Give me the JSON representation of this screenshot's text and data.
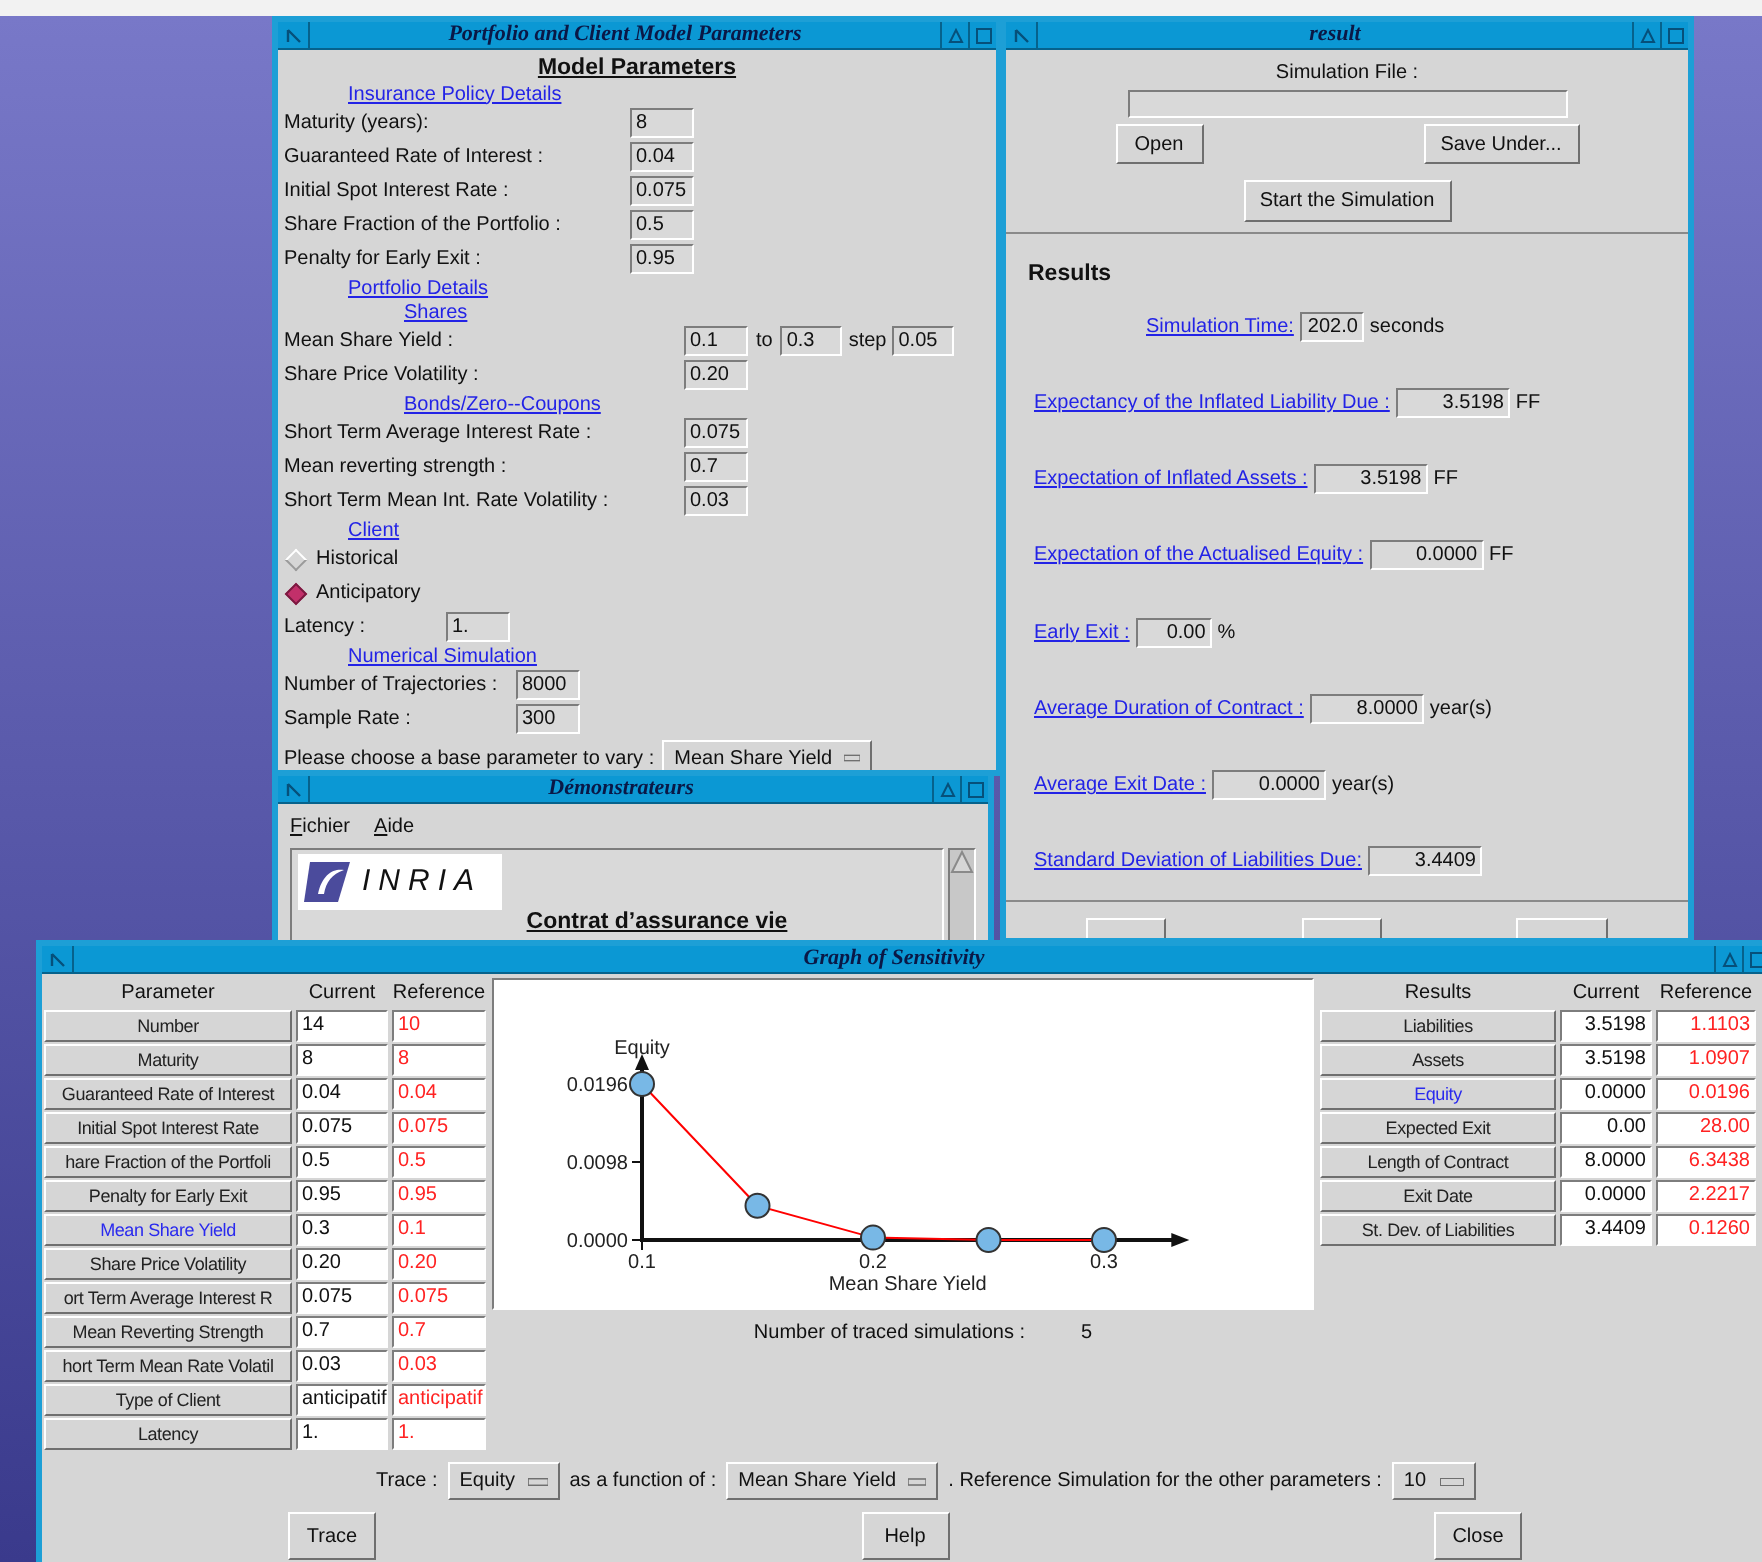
{
  "parameters_window": {
    "title": "Portfolio and Client Model Parameters",
    "heading": "Model Parameters",
    "sections": [
      {
        "kind": "policy",
        "title": "Insurance Policy Details",
        "fields": [
          {
            "label": "Maturity (years):",
            "value": "8"
          },
          {
            "label": "Guaranteed Rate of Interest :",
            "value": "0.04"
          },
          {
            "label": "Initial Spot Interest Rate :",
            "value": "0.075"
          },
          {
            "label": "Share Fraction of the Portfolio :",
            "value": "0.5"
          },
          {
            "label": "Penalty for Early Exit :",
            "value": "0.95"
          }
        ]
      },
      {
        "kind": "portfolio",
        "title": "Portfolio Details",
        "subsections": [
          {
            "title": "Shares",
            "fields": [
              {
                "label": "Mean Share Yield :",
                "value": "0.1",
                "to_label": "to",
                "to": "0.3",
                "step_label": "step",
                "step": "0.05"
              },
              {
                "label": "Share Price Volatility :",
                "value": "0.20"
              }
            ]
          },
          {
            "title": "Bonds/Zero--Coupons",
            "fields": [
              {
                "label": "Short Term Average Interest Rate :",
                "value": "0.075"
              },
              {
                "label": "Mean reverting strength :",
                "value": "0.7"
              },
              {
                "label": "Short Term Mean Int. Rate Volatility :",
                "value": "0.03"
              }
            ]
          }
        ]
      },
      {
        "kind": "client",
        "title": "Client",
        "options": [
          {
            "label": "Historical",
            "selected": false
          },
          {
            "label": "Anticipatory",
            "selected": true
          }
        ],
        "fields": [
          {
            "label": "Latency :",
            "value": "1."
          }
        ]
      },
      {
        "kind": "simulation",
        "title": "Numerical Simulation",
        "fields": [
          {
            "label": "Number of Trajectories :",
            "value": "8000"
          },
          {
            "label": "Sample Rate :",
            "value": "300"
          }
        ]
      }
    ],
    "base_parameter": {
      "label": "Please choose a base parameter to vary :",
      "value": "Mean Share Yield"
    }
  },
  "result_window": {
    "title": "result",
    "file_label": "Simulation File :",
    "open_button": "Open",
    "save_button": "Save Under...",
    "start_button": "Start the Simulation",
    "results_heading": "Results",
    "results": [
      {
        "kind": "timing",
        "label": "Simulation Time:",
        "value": "202.0",
        "unit": "seconds"
      },
      {
        "kind": "metric",
        "label": "Expectancy of the Inflated Liability Due :",
        "value": "3.5198",
        "unit": "FF"
      },
      {
        "kind": "metric",
        "label": "Expectation of Inflated Assets :",
        "value": "3.5198",
        "unit": "FF"
      },
      {
        "kind": "metric",
        "label": "Expectation of the Actualised Equity :",
        "value": "0.0000",
        "unit": "FF"
      },
      {
        "kind": "percent",
        "label": "Early Exit :",
        "value": "0.00",
        "unit": "%"
      },
      {
        "kind": "metric",
        "label": "Average Duration of Contract :",
        "value": "8.0000",
        "unit": "year(s)"
      },
      {
        "kind": "metric",
        "label": "Average Exit Date :",
        "value": "0.0000",
        "unit": "year(s)"
      },
      {
        "kind": "metric",
        "label": "Standard Deviation of Liabilities Due:",
        "value": "3.4409"
      }
    ]
  },
  "demo_window": {
    "title": "Démonstrateurs",
    "menu": [
      "Fichier",
      "Aide"
    ],
    "logo_text": "INRIA",
    "heading": "Contrat d’assurance vie"
  },
  "graph_window": {
    "title": "Graph of Sensitivity",
    "parameters_table": {
      "columns": [
        "Parameter",
        "Current",
        "Reference"
      ],
      "rows": [
        {
          "name": "Number",
          "current": "14",
          "reference": "10",
          "selected": false
        },
        {
          "name": "Maturity",
          "current": "8",
          "reference": "8",
          "selected": false
        },
        {
          "name": "Guaranteed Rate of Interest",
          "current": "0.04",
          "reference": "0.04",
          "selected": false
        },
        {
          "name": "Initial Spot Interest Rate",
          "current": "0.075",
          "reference": "0.075",
          "selected": false
        },
        {
          "name": "hare Fraction of the Portfoli",
          "current": "0.5",
          "reference": "0.5",
          "selected": false
        },
        {
          "name": "Penalty for Early Exit",
          "current": "0.95",
          "reference": "0.95",
          "selected": false
        },
        {
          "name": "Mean Share Yield",
          "current": "0.3",
          "reference": "0.1",
          "selected": true
        },
        {
          "name": "Share Price Volatility",
          "current": "0.20",
          "reference": "0.20",
          "selected": false
        },
        {
          "name": "ort Term Average Interest R",
          "current": "0.075",
          "reference": "0.075",
          "selected": false
        },
        {
          "name": "Mean Reverting Strength",
          "current": "0.7",
          "reference": "0.7",
          "selected": false
        },
        {
          "name": "hort Term Mean Rate Volatil",
          "current": "0.03",
          "reference": "0.03",
          "selected": false
        },
        {
          "name": "Type of Client",
          "current": "anticipatif",
          "reference": "anticipatif",
          "selected": false
        },
        {
          "name": "Latency",
          "current": "1.",
          "reference": "1.",
          "selected": false
        }
      ]
    },
    "chart_data": {
      "type": "line",
      "xlabel": "Mean Share Yield",
      "ylabel": "Equity",
      "x": [
        0.1,
        0.15,
        0.2,
        0.25,
        0.3
      ],
      "series": [
        {
          "color": "#ff0000",
          "marker": "o",
          "values": [
            0.0196,
            0.0043,
            0.0003,
            0,
            0
          ]
        }
      ],
      "xlim": [
        0.1,
        0.33
      ],
      "ylim": [
        0,
        0.0216
      ],
      "xticks": [
        0.1,
        0.2,
        0.3
      ],
      "yticks": [
        {
          "value": 0,
          "label": "0.0000"
        },
        {
          "value": 0.0098,
          "label": "0.0098"
        },
        {
          "value": 0.0196,
          "label": "0.0196"
        }
      ]
    },
    "traced": {
      "label": "Number of traced simulations :",
      "value": "5"
    },
    "results_table": {
      "columns": [
        "Results",
        "Current",
        "Reference"
      ],
      "rows": [
        {
          "name": "Liabilities",
          "current": "3.5198",
          "reference": "1.1103",
          "selected": false
        },
        {
          "name": "Assets",
          "current": "3.5198",
          "reference": "1.0907",
          "selected": false
        },
        {
          "name": "Equity",
          "current": "0.0000",
          "reference": "0.0196",
          "selected": true
        },
        {
          "name": "Expected Exit",
          "current": "0.00",
          "reference": "28.00",
          "selected": false
        },
        {
          "name": "Length of Contract",
          "current": "8.0000",
          "reference": "6.3438",
          "selected": false
        },
        {
          "name": "Exit Date",
          "current": "0.0000",
          "reference": "2.2217",
          "selected": false
        },
        {
          "name": "St. Dev. of Liabilities",
          "current": "3.4409",
          "reference": "0.1260",
          "selected": false
        }
      ]
    },
    "trace_bar": {
      "trace_label": "Trace :",
      "trace_value": "Equity",
      "function_label": "as a function of :",
      "function_value": "Mean Share Yield",
      "reference_label": ". Reference Simulation for the other parameters :",
      "reference_value": "10"
    },
    "buttons": [
      "Trace",
      "Help",
      "Close"
    ]
  }
}
